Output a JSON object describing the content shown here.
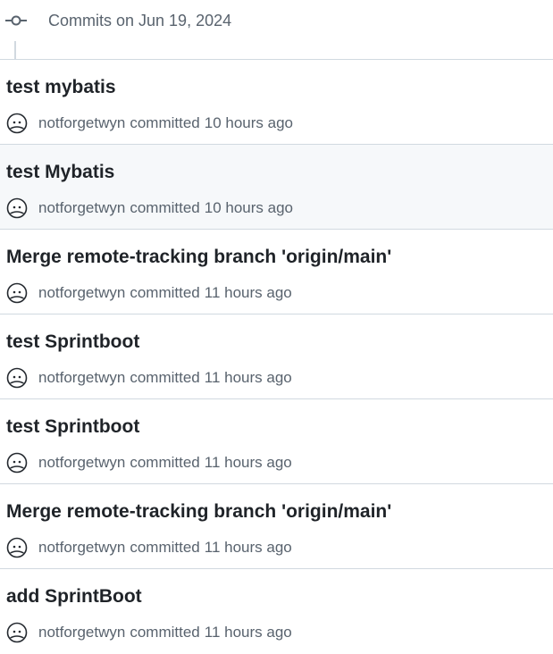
{
  "header": {
    "title": "Commits on Jun 19, 2024",
    "icon": "git-commit-icon"
  },
  "colors": {
    "text_primary": "#1f2328",
    "text_muted": "#59636e",
    "border": "#d1d9e0",
    "hover_bg": "#f6f8fa",
    "avatar_stroke": "#24292f"
  },
  "commits": [
    {
      "title": "test mybatis",
      "author": "notforgetwyn",
      "action": "committed",
      "time": "10 hours ago",
      "avatar_icon": "user-avatar-icon"
    },
    {
      "title": "test Mybatis",
      "author": "notforgetwyn",
      "action": "committed",
      "time": "10 hours ago",
      "avatar_icon": "user-avatar-icon"
    },
    {
      "title": "Merge remote-tracking branch 'origin/main'",
      "author": "notforgetwyn",
      "action": "committed",
      "time": "11 hours ago",
      "avatar_icon": "user-avatar-icon"
    },
    {
      "title": "test Sprintboot",
      "author": "notforgetwyn",
      "action": "committed",
      "time": "11 hours ago",
      "avatar_icon": "user-avatar-icon"
    },
    {
      "title": "test Sprintboot",
      "author": "notforgetwyn",
      "action": "committed",
      "time": "11 hours ago",
      "avatar_icon": "user-avatar-icon"
    },
    {
      "title": "Merge remote-tracking branch 'origin/main'",
      "author": "notforgetwyn",
      "action": "committed",
      "time": "11 hours ago",
      "avatar_icon": "user-avatar-icon"
    },
    {
      "title": "add SprintBoot",
      "author": "notforgetwyn",
      "action": "committed",
      "time": "11 hours ago",
      "avatar_icon": "user-avatar-icon"
    }
  ]
}
